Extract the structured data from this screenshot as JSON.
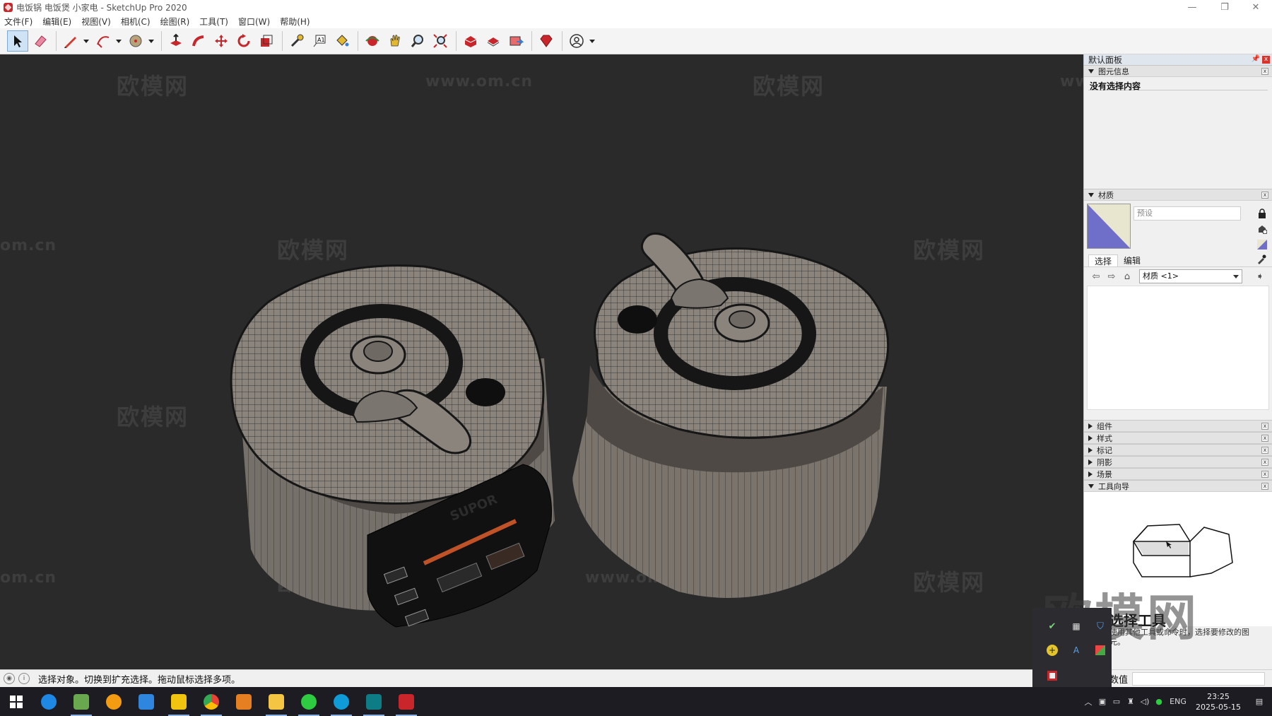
{
  "window": {
    "title": "电饭锅 电饭煲 小家电 - SketchUp Pro 2020",
    "minimize": "—",
    "restore": "❐",
    "close": "✕"
  },
  "menu": {
    "items": [
      "文件(F)",
      "编辑(E)",
      "视图(V)",
      "相机(C)",
      "绘图(R)",
      "工具(T)",
      "窗口(W)",
      "帮助(H)"
    ]
  },
  "toolbar": {
    "tools": [
      "select",
      "eraser",
      "line",
      "arc",
      "shape",
      "push-pull",
      "follow-me",
      "move",
      "rotate",
      "scale",
      "tape",
      "text",
      "paint",
      "orbit",
      "pan",
      "zoom",
      "zoom-extents",
      "warehouse",
      "extension-warehouse",
      "layout",
      "ruby",
      "account"
    ]
  },
  "viewport": {
    "watermarks": [
      "欧模网",
      "www.om.cn",
      "om.cn"
    ],
    "brand_text": "SUPOR",
    "background": "#2a2a2a"
  },
  "tray": {
    "title": "默认面板",
    "pin": "📌",
    "close": "x",
    "entity_info": {
      "header": "图元信息",
      "text": "没有选择内容"
    },
    "materials": {
      "header": "材质",
      "name_placeholder": "预设",
      "tab_select": "选择",
      "tab_edit": "编辑",
      "library": "材质 <1>",
      "swatch_color": "#6f6fc9"
    },
    "collapsed": [
      "组件",
      "样式",
      "标记",
      "阴影",
      "场景"
    ],
    "instructor": {
      "header": "工具向导",
      "title": "选择工具",
      "desc": "使用其他工具或命令时，选择要修改的图元。"
    }
  },
  "status": {
    "text": "选择对象。切换到扩充选择。拖动鼠标选择多项。",
    "measure_label": "数值"
  },
  "taskbar": {
    "lang": "ENG",
    "time": "23:25",
    "date": "2025-05-15"
  },
  "watermark_big": "欧模网",
  "colors": {
    "accent": "#0078d7",
    "sketchup_red": "#c8262b"
  }
}
